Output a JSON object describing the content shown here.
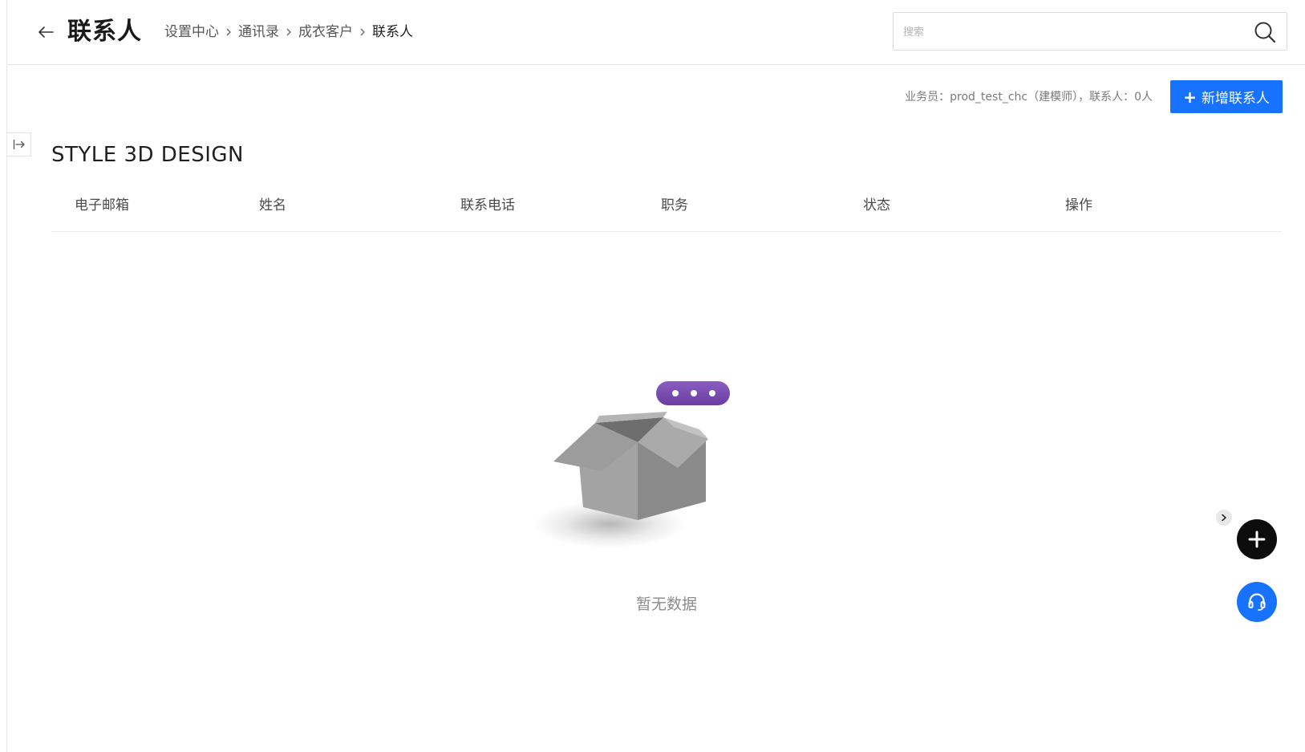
{
  "header": {
    "title": "联系人",
    "breadcrumb": [
      {
        "label": "设置中心"
      },
      {
        "label": "通讯录"
      },
      {
        "label": "成衣客户"
      },
      {
        "label": "联系人"
      }
    ],
    "search": {
      "placeholder": "搜索",
      "value": ""
    }
  },
  "toolbar": {
    "info": "业务员：prod_test_chc（建模师），联系人：0人",
    "add_button_label": "新增联系人"
  },
  "section": {
    "title": "STYLE 3D DESIGN"
  },
  "table": {
    "columns": [
      "电子邮箱",
      "姓名",
      "联系电话",
      "职务",
      "状态",
      "操作"
    ],
    "rows": []
  },
  "empty_state": {
    "text": "暂无数据"
  },
  "icons": {
    "back": "arrow-left-icon",
    "search": "search-icon",
    "collapse": "expand-sidebar-icon",
    "chevron": "chevron-right-icon",
    "plus": "plus-icon",
    "support": "headset-icon"
  },
  "colors": {
    "primary": "#1672ff",
    "dark_fab": "#0d0d0d",
    "bubble": "#7b4fb0",
    "box": "#9a9a9a"
  }
}
